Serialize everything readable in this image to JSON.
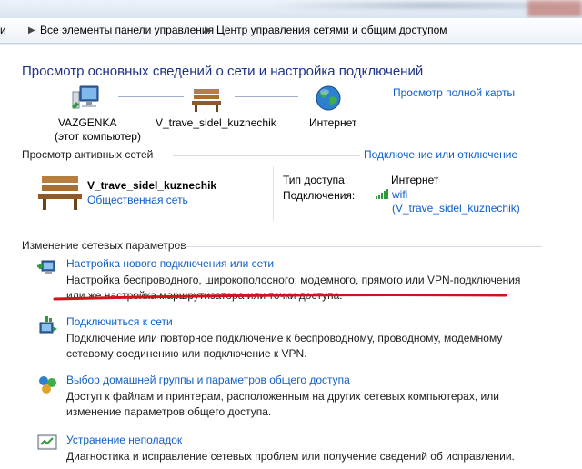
{
  "breadcrumb": {
    "item1": "и",
    "item2": "Все элементы панели управления",
    "item3": "Центр управления сетями и общим доступом"
  },
  "page_title": "Просмотр основных сведений о сети и настройка подключений",
  "full_map_link": "Просмотр полной карты",
  "network_map": {
    "computer_name": "VAZGENKA",
    "computer_sub": "(этот компьютер)",
    "network_name": "V_trave_sidel_kuznechik",
    "internet": "Интернет"
  },
  "active_networks": {
    "header": "Просмотр активных сетей",
    "connect_link": "Подключение или отключение",
    "network_name": "V_trave_sidel_kuznechik",
    "network_type": "Общественная сеть",
    "access_type_label": "Тип доступа:",
    "access_type_value": "Интернет",
    "connections_label": "Подключения:",
    "connection_name": "wifi",
    "connection_ssid": "(V_trave_sidel_kuznechik)"
  },
  "change_settings": {
    "header": "Изменение сетевых параметров",
    "tasks": [
      {
        "title": "Настройка нового подключения или сети",
        "desc1": "Настройка беспроводного, широкополосного, модемного, прямого или VPN-подключения",
        "desc2": "или же настройка маршрутизатора или точки доступа."
      },
      {
        "title": "Подключиться к сети",
        "desc1": "Подключение или повторное подключение к беспроводному, проводному, модемному",
        "desc2": "сетевому соединению или подключение к VPN."
      },
      {
        "title": "Выбор домашней группы и параметров общего доступа",
        "desc1": "Доступ к файлам и принтерам, расположенным на других сетевых компьютерах, или",
        "desc2": "изменение параметров общего доступа."
      },
      {
        "title": "Устранение неполадок",
        "desc1": "Диагностика и исправление сетевых проблем или получение сведений об исправлении."
      }
    ]
  },
  "colors": {
    "link": "#0f5fc7",
    "title": "#1e3287",
    "underline_annotation": "#d0141b"
  }
}
